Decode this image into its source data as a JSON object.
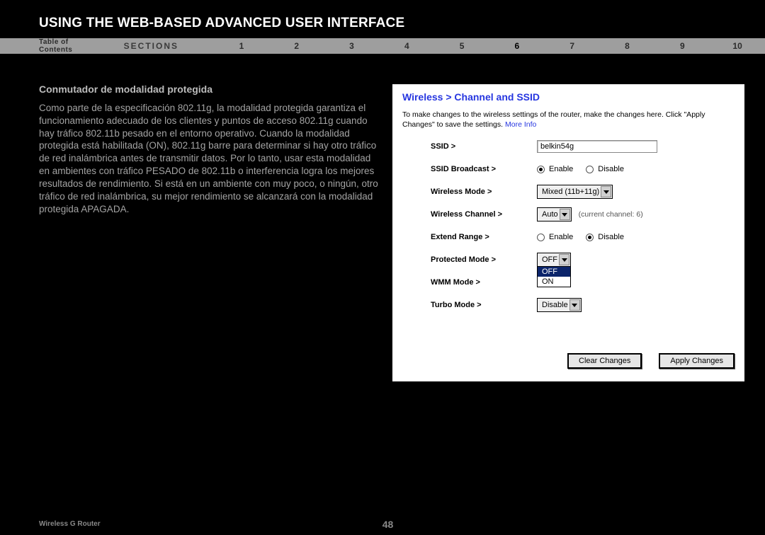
{
  "header": {
    "title": "USING THE WEB-BASED ADVANCED USER INTERFACE"
  },
  "nav": {
    "toc": "Table of Contents",
    "sections_label": "SECTIONS",
    "items": [
      "1",
      "2",
      "3",
      "4",
      "5",
      "6",
      "7",
      "8",
      "9",
      "10"
    ],
    "active": "6"
  },
  "left": {
    "subheading": "Conmutador de modalidad protegida",
    "body": "Como parte de la especificación 802.11g, la modalidad protegida garantiza el funcionamiento adecuado de los clientes y puntos de acceso 802.11g cuando hay tráfico 802.11b pesado en el entorno operativo. Cuando la modalidad protegida está habilitada (ON), 802.11g barre para determinar si hay otro tráfico de red inalámbrica antes de transmitir datos. Por lo tanto, usar esta modalidad en ambientes con tráfico PESADO de 802.11b o interferencia logra los mejores resultados de rendimiento. Si está en un ambiente con muy poco, o ningún, otro tráfico de red inalámbrica, su mejor rendimiento se alcanzará con la modalidad protegida APAGADA."
  },
  "panel": {
    "title": "Wireless > Channel and SSID",
    "desc": "To make changes to the wireless settings of the router, make the changes here. Click \"Apply Changes\" to save the settings.",
    "more_info": "More Info",
    "rows": {
      "ssid": {
        "label": "SSID >",
        "value": "belkin54g"
      },
      "ssid_broadcast": {
        "label": "SSID Broadcast >",
        "enable": "Enable",
        "disable": "Disable",
        "selected": "enable"
      },
      "wireless_mode": {
        "label": "Wireless Mode >",
        "value": "Mixed (11b+11g)"
      },
      "wireless_channel": {
        "label": "Wireless Channel >",
        "value": "Auto",
        "note": "(current channel: 6)"
      },
      "extend_range": {
        "label": "Extend Range >",
        "enable": "Enable",
        "disable": "Disable",
        "selected": "disable"
      },
      "protected_mode": {
        "label": "Protected Mode >",
        "value": "OFF",
        "options": [
          "OFF",
          "ON"
        ],
        "selected_option": "OFF",
        "open": true
      },
      "wmm_mode": {
        "label": "WMM Mode >"
      },
      "turbo_mode": {
        "label": "Turbo Mode >",
        "value": "Disable"
      }
    },
    "buttons": {
      "clear": "Clear Changes",
      "apply": "Apply Changes"
    }
  },
  "footer": {
    "left": "Wireless G Router",
    "page": "48"
  }
}
